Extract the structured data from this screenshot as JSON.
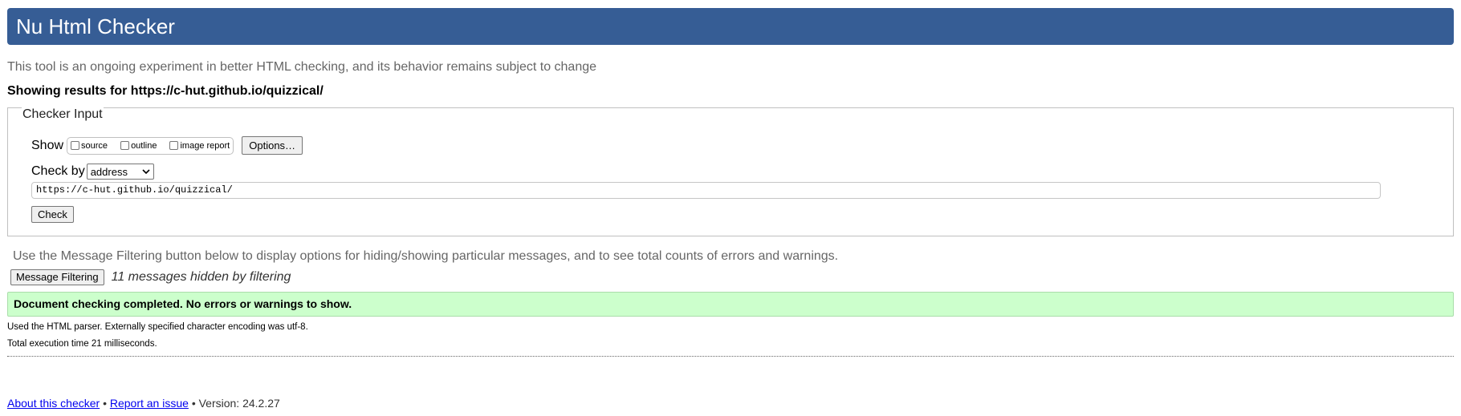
{
  "header": {
    "title": "Nu Html Checker",
    "background": "#365d95"
  },
  "tagline": "This tool is an ongoing experiment in better HTML checking, and its behavior remains subject to change",
  "results_for": {
    "prefix": "Showing results for ",
    "url": "https://c-hut.github.io/quizzical/"
  },
  "checker_input": {
    "legend": "Checker Input",
    "show_label": "Show",
    "show_options": [
      {
        "label": "source",
        "checked": false
      },
      {
        "label": "outline",
        "checked": false
      },
      {
        "label": "image report",
        "checked": false
      }
    ],
    "options_button": "Options…",
    "check_by_label": "Check by",
    "check_by_selected": "address",
    "url_value": "https://c-hut.github.io/quizzical/",
    "check_button": "Check"
  },
  "filtering": {
    "help_text": "Use the Message Filtering button below to display options for hiding/showing particular messages, and to see total counts of errors and warnings.",
    "button": "Message Filtering",
    "hidden_count_text": "11 messages hidden by filtering"
  },
  "result": {
    "message": "Document checking completed. No errors or warnings to show.",
    "background": "#ccffcc"
  },
  "details": {
    "parser": "Used the HTML parser. Externally specified character encoding was utf-8.",
    "execution_time": "Total execution time 21 milliseconds."
  },
  "footer": {
    "about_link": "About this checker",
    "separator": "•",
    "report_link": "Report an issue",
    "version": "Version: 24.2.27"
  }
}
